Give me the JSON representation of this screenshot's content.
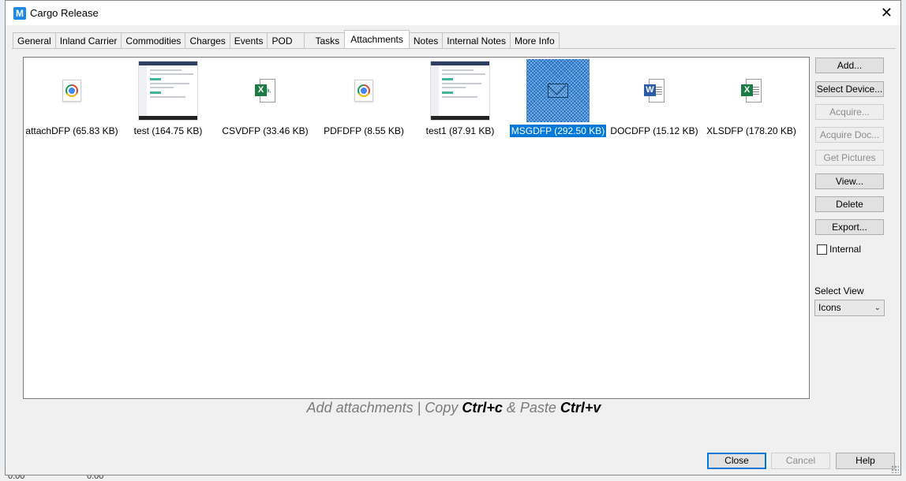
{
  "window": {
    "title": "Cargo Release",
    "app_icon_letter": "M"
  },
  "tabs": [
    "General",
    "Inland Carrier",
    "Commodities",
    "Charges",
    "Events",
    "POD",
    "Tasks",
    "Attachments",
    "Notes",
    "Internal Notes",
    "More Info"
  ],
  "active_tab": "Attachments",
  "attachments": [
    {
      "label": "attachDFP (65.83 KB)",
      "icon": "chrome-icon",
      "selected": false
    },
    {
      "label": "test (164.75 KB)",
      "icon": "screenshot-thumbnail",
      "selected": false
    },
    {
      "label": "CSVDFP (33.46 KB)",
      "icon": "excel-csv-icon",
      "selected": false
    },
    {
      "label": "PDFDFP (8.55 KB)",
      "icon": "chrome-icon",
      "selected": false
    },
    {
      "label": "test1 (87.91 KB)",
      "icon": "screenshot-thumbnail",
      "selected": false
    },
    {
      "label": "MSGDFP (292.50 KB)",
      "icon": "envelope-icon",
      "selected": true
    },
    {
      "label": "DOCDFP (15.12 KB)",
      "icon": "word-icon",
      "selected": false
    },
    {
      "label": "XLSDFP (178.20 KB)",
      "icon": "excel-icon",
      "selected": false
    }
  ],
  "side_buttons": {
    "add": "Add...",
    "select_device": "Select Device...",
    "acquire": "Acquire...",
    "acquire_doc": "Acquire Doc...",
    "get_pictures": "Get Pictures",
    "view": "View...",
    "delete": "Delete",
    "export": "Export..."
  },
  "internal_checkbox": {
    "label": "Internal",
    "checked": false
  },
  "select_view": {
    "label": "Select View",
    "value": "Icons"
  },
  "hint": {
    "part1": "Add attachments | Copy ",
    "key1": "Ctrl+c",
    "part2": " & Paste ",
    "key2": "Ctrl+v"
  },
  "bottom_buttons": {
    "close": "Close",
    "cancel": "Cancel",
    "help": "Help"
  },
  "background_values": [
    "0.00",
    "0.00"
  ]
}
